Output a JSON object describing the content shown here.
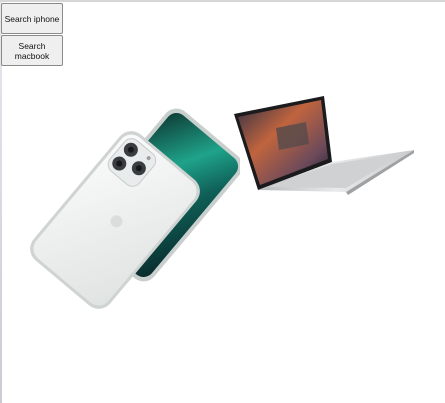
{
  "buttons": {
    "search_iphone": "Search iphone",
    "search_macbook": "Search macbook"
  },
  "images": {
    "iphone": {
      "icon": "iphone-image"
    },
    "macbook": {
      "icon": "macbook-image"
    }
  },
  "colors": {
    "button_bg": "#efefef",
    "button_border": "#8a8a8a",
    "iphone_screen": "#1a8f7c",
    "iphone_body": "#e7ebe9",
    "macbook_body": "#d8d8d8",
    "macbook_wallpaper": "#c0643e"
  }
}
